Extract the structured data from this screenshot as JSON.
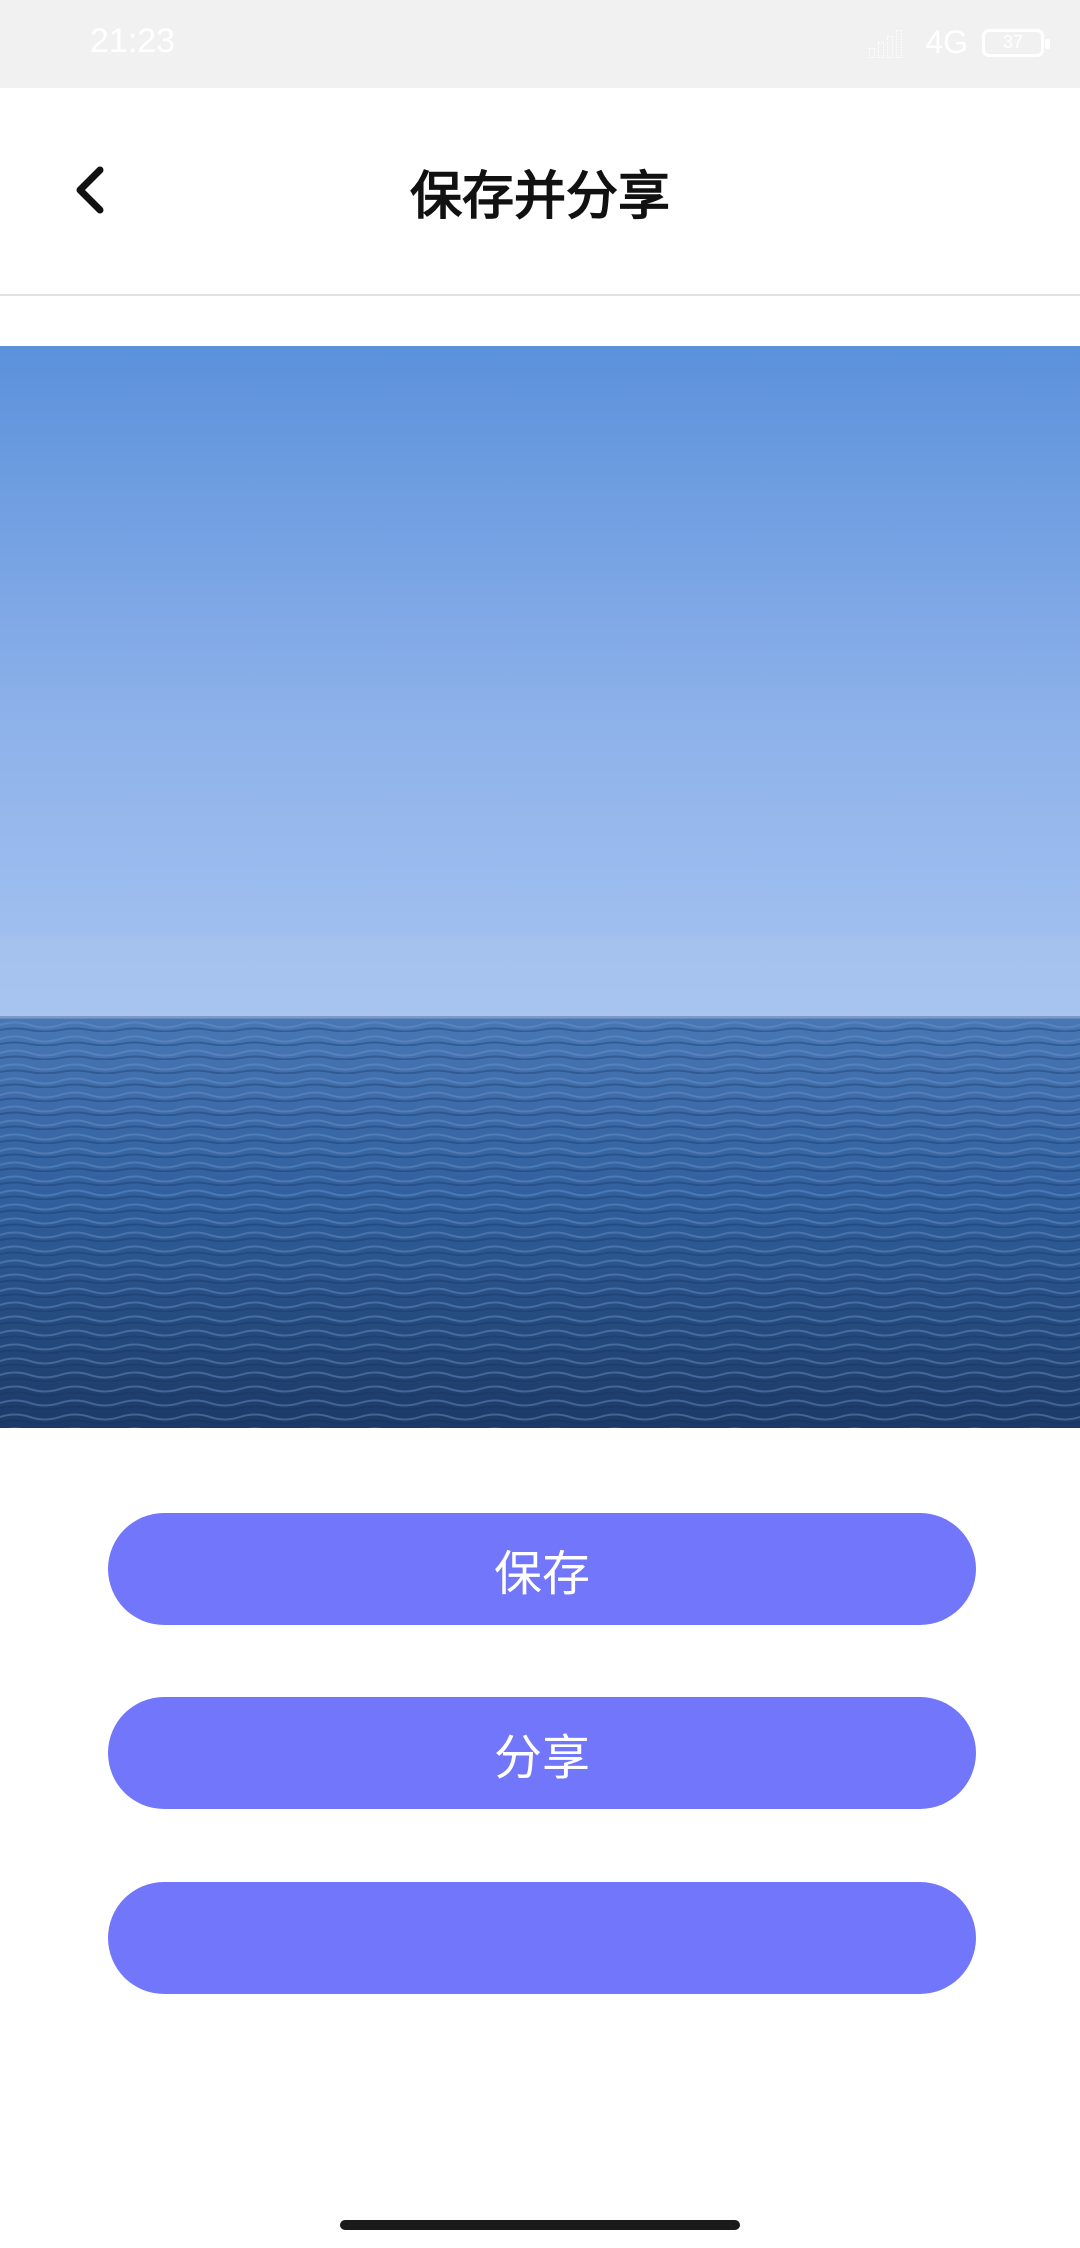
{
  "status_bar": {
    "time": "21:23",
    "network": "4G",
    "battery": "37",
    "icons": [
      "signal-icon",
      "battery-icon"
    ]
  },
  "header": {
    "title": "保存并分享",
    "back_icon": "chevron-left-icon"
  },
  "preview": {
    "subject": "ocean-horizon-image",
    "colors": {
      "sky_top": "#5b91db",
      "sky_bottom": "#a6c4f1",
      "sea_top": "#3c6eae",
      "sea_bottom": "#1c3a66"
    }
  },
  "actions": {
    "save_label": "保存",
    "share_label": "分享",
    "third_label": ""
  },
  "colors": {
    "accent": "#7276fb",
    "status_bar_bg": "#f1f1f1",
    "divider": "#e2e2e2"
  }
}
